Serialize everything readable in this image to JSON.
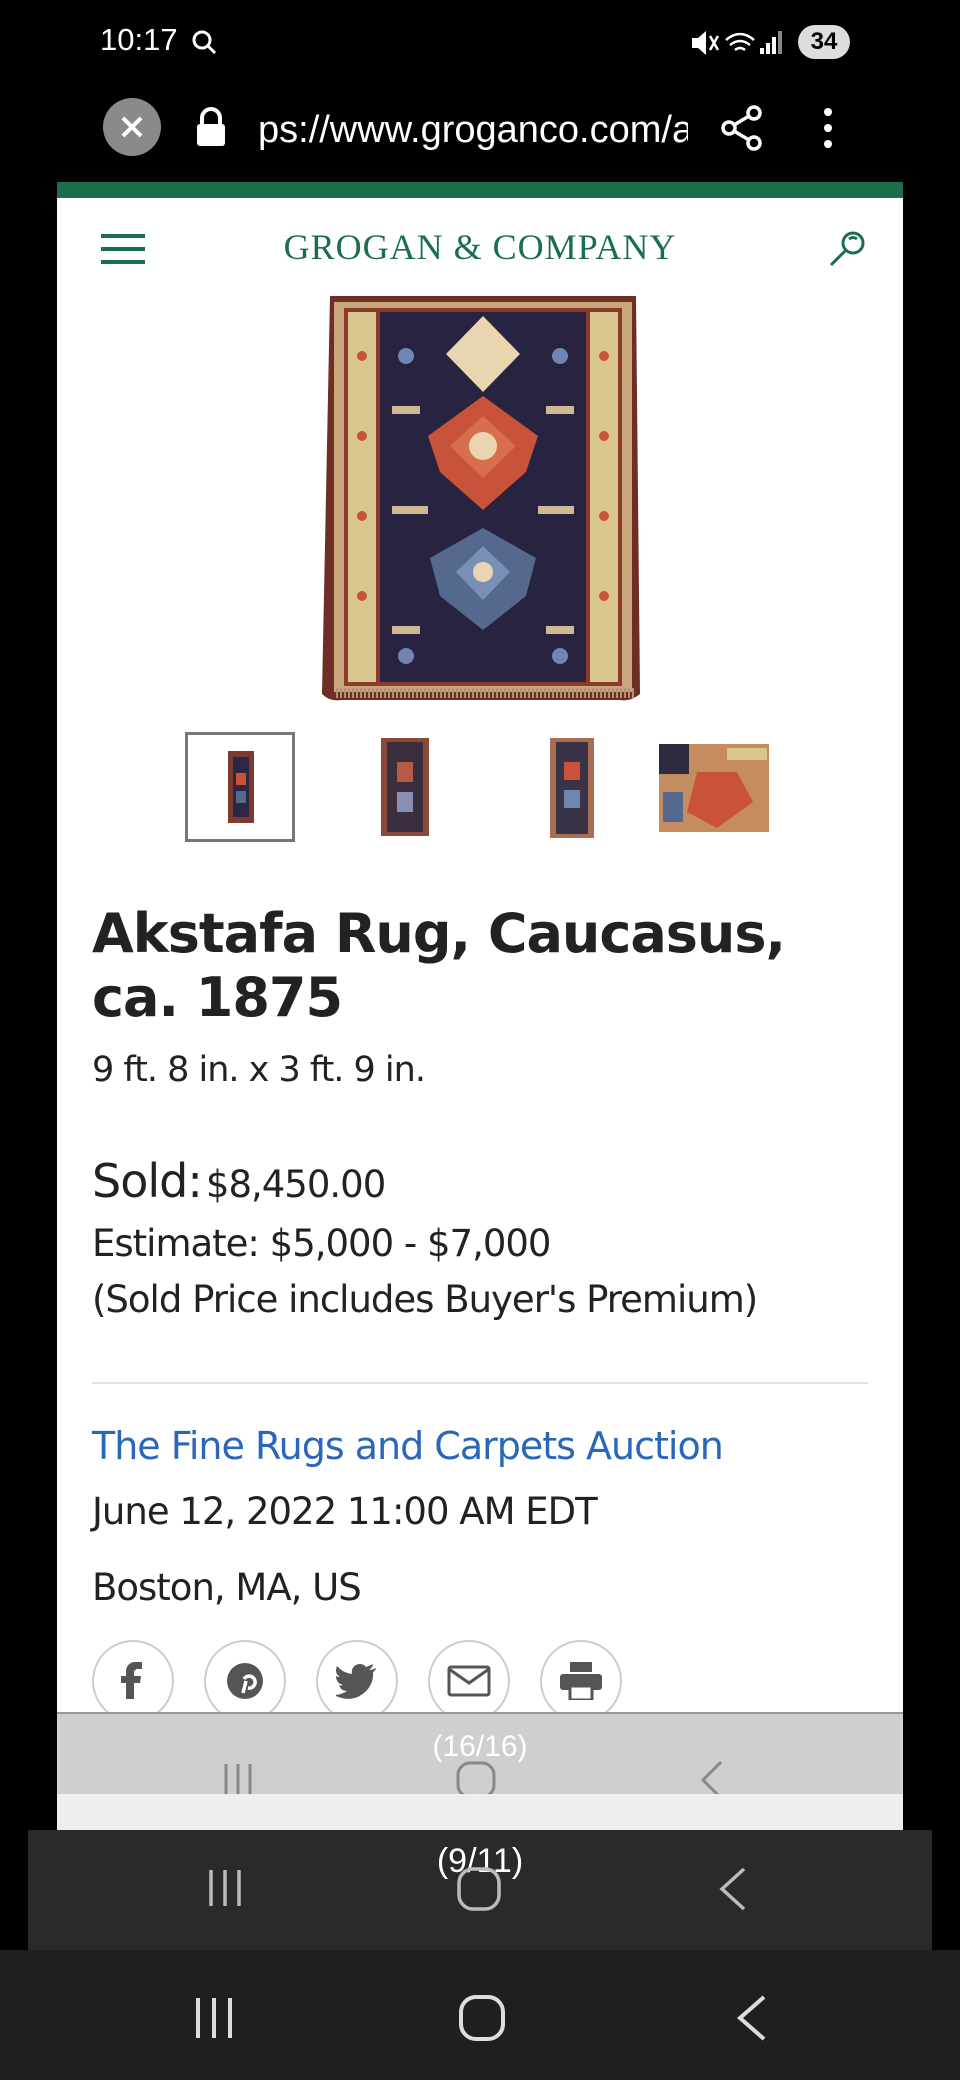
{
  "status_bar": {
    "time": "10:17",
    "battery": "34",
    "icons": [
      "search-icon",
      "mute-icon",
      "wifi-icon",
      "signal-icon"
    ]
  },
  "browser": {
    "url_visible": "ps://www.groganco.com/a",
    "icons": [
      "close-icon",
      "lock-icon",
      "share-icon",
      "more-vert-icon"
    ]
  },
  "site": {
    "brand": "GROGAN & COMPANY",
    "accent_color": "#1b6e4b",
    "link_color": "#2b67b8"
  },
  "lot": {
    "title": "Akstafa Rug, Caucasus, ca. 1875",
    "dimensions": "9 ft. 8 in. x 3 ft. 9 in.",
    "sold_label": "Sold:",
    "sold_price": "$8,450.00",
    "estimate": "Estimate: $5,000 - $7,000",
    "premium_note": "(Sold Price includes Buyer's Premium)",
    "thumbnail_count": 4,
    "selected_thumbnail": 1
  },
  "auction": {
    "name": "The Fine Rugs and Carpets Auction",
    "date": "June 12, 2022 11:00 AM EDT",
    "location": "Boston, MA, US"
  },
  "share_icons": [
    "facebook-icon",
    "pinterest-icon",
    "twitter-icon",
    "email-icon",
    "print-icon"
  ],
  "overlays": {
    "inner_counter": "(16/16)",
    "outer_counter": "(9/11)"
  }
}
